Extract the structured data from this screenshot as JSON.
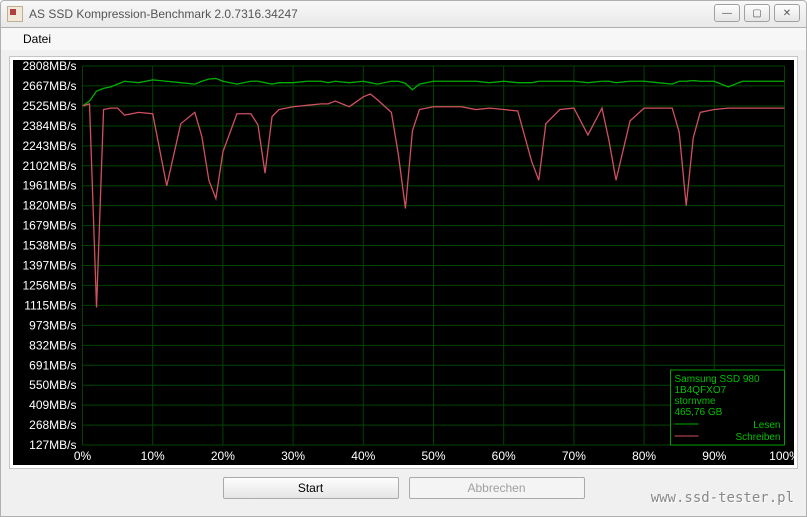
{
  "window": {
    "title": "AS SSD Kompression-Benchmark 2.0.7316.34247"
  },
  "menu": {
    "file": "Datei"
  },
  "buttons": {
    "start": "Start",
    "cancel": "Abbrechen"
  },
  "watermark": "www.ssd-tester.pl",
  "legend": {
    "device": "Samsung SSD 980",
    "firmware": "1B4QFXO7",
    "driver": "stornvme",
    "capacity": "465,76 GB",
    "read": "Lesen",
    "write": "Schreiben"
  },
  "chart_data": {
    "type": "line",
    "title": "",
    "xlabel": "",
    "ylabel": "",
    "xlim": [
      0,
      100
    ],
    "ylim": [
      0,
      2808
    ],
    "y_ticks": [
      127,
      268,
      409,
      550,
      691,
      832,
      973,
      1115,
      1256,
      1397,
      1538,
      1679,
      1820,
      1961,
      2102,
      2243,
      2384,
      2525,
      2667,
      2808
    ],
    "y_tick_labels": [
      "127MB/s",
      "268MB/s",
      "409MB/s",
      "550MB/s",
      "691MB/s",
      "832MB/s",
      "973MB/s",
      "1115MB/s",
      "1256MB/s",
      "1397MB/s",
      "1538MB/s",
      "1679MB/s",
      "1820MB/s",
      "1961MB/s",
      "2102MB/s",
      "2243MB/s",
      "2384MB/s",
      "2525MB/s",
      "2667MB/s",
      "2808MB/s"
    ],
    "x_ticks": [
      0,
      10,
      20,
      30,
      40,
      50,
      60,
      70,
      80,
      90,
      100
    ],
    "x_tick_labels": [
      "0%",
      "10%",
      "20%",
      "30%",
      "40%",
      "50%",
      "60%",
      "70%",
      "80%",
      "90%",
      "100%"
    ],
    "x": [
      0,
      1,
      2,
      3,
      4,
      5,
      6,
      8,
      10,
      12,
      14,
      16,
      17,
      18,
      19,
      20,
      22,
      24,
      25,
      26,
      27,
      28,
      30,
      32,
      34,
      35,
      36,
      38,
      40,
      41,
      42,
      44,
      45,
      46,
      47,
      48,
      50,
      52,
      54,
      56,
      58,
      60,
      62,
      64,
      65,
      66,
      68,
      70,
      72,
      74,
      75,
      76,
      78,
      80,
      82,
      84,
      85,
      86,
      87,
      88,
      90,
      92,
      94,
      96,
      98,
      100
    ],
    "series": [
      {
        "name": "Lesen",
        "color": "#00b000",
        "values": [
          2525,
          2560,
          2630,
          2650,
          2660,
          2680,
          2700,
          2690,
          2710,
          2700,
          2690,
          2680,
          2700,
          2715,
          2720,
          2700,
          2680,
          2700,
          2700,
          2690,
          2680,
          2690,
          2690,
          2700,
          2700,
          2690,
          2700,
          2690,
          2700,
          2690,
          2680,
          2700,
          2700,
          2685,
          2640,
          2680,
          2700,
          2700,
          2700,
          2700,
          2690,
          2700,
          2690,
          2690,
          2700,
          2700,
          2700,
          2700,
          2690,
          2700,
          2700,
          2690,
          2700,
          2700,
          2690,
          2680,
          2700,
          2700,
          2705,
          2700,
          2700,
          2660,
          2700,
          2700,
          2700,
          2700
        ]
      },
      {
        "name": "Schreiben",
        "color": "#d05060",
        "values": [
          2525,
          2540,
          1100,
          2500,
          2510,
          2510,
          2460,
          2480,
          2470,
          1960,
          2400,
          2480,
          2310,
          2000,
          1870,
          2200,
          2470,
          2470,
          2390,
          2050,
          2450,
          2500,
          2520,
          2530,
          2540,
          2540,
          2560,
          2520,
          2590,
          2610,
          2570,
          2480,
          2180,
          1800,
          2350,
          2500,
          2520,
          2520,
          2520,
          2500,
          2510,
          2500,
          2490,
          2130,
          2000,
          2400,
          2500,
          2510,
          2320,
          2510,
          2280,
          2000,
          2420,
          2510,
          2510,
          2510,
          2340,
          1820,
          2300,
          2480,
          2500,
          2510,
          2510,
          2510,
          2510,
          2510
        ]
      }
    ]
  }
}
